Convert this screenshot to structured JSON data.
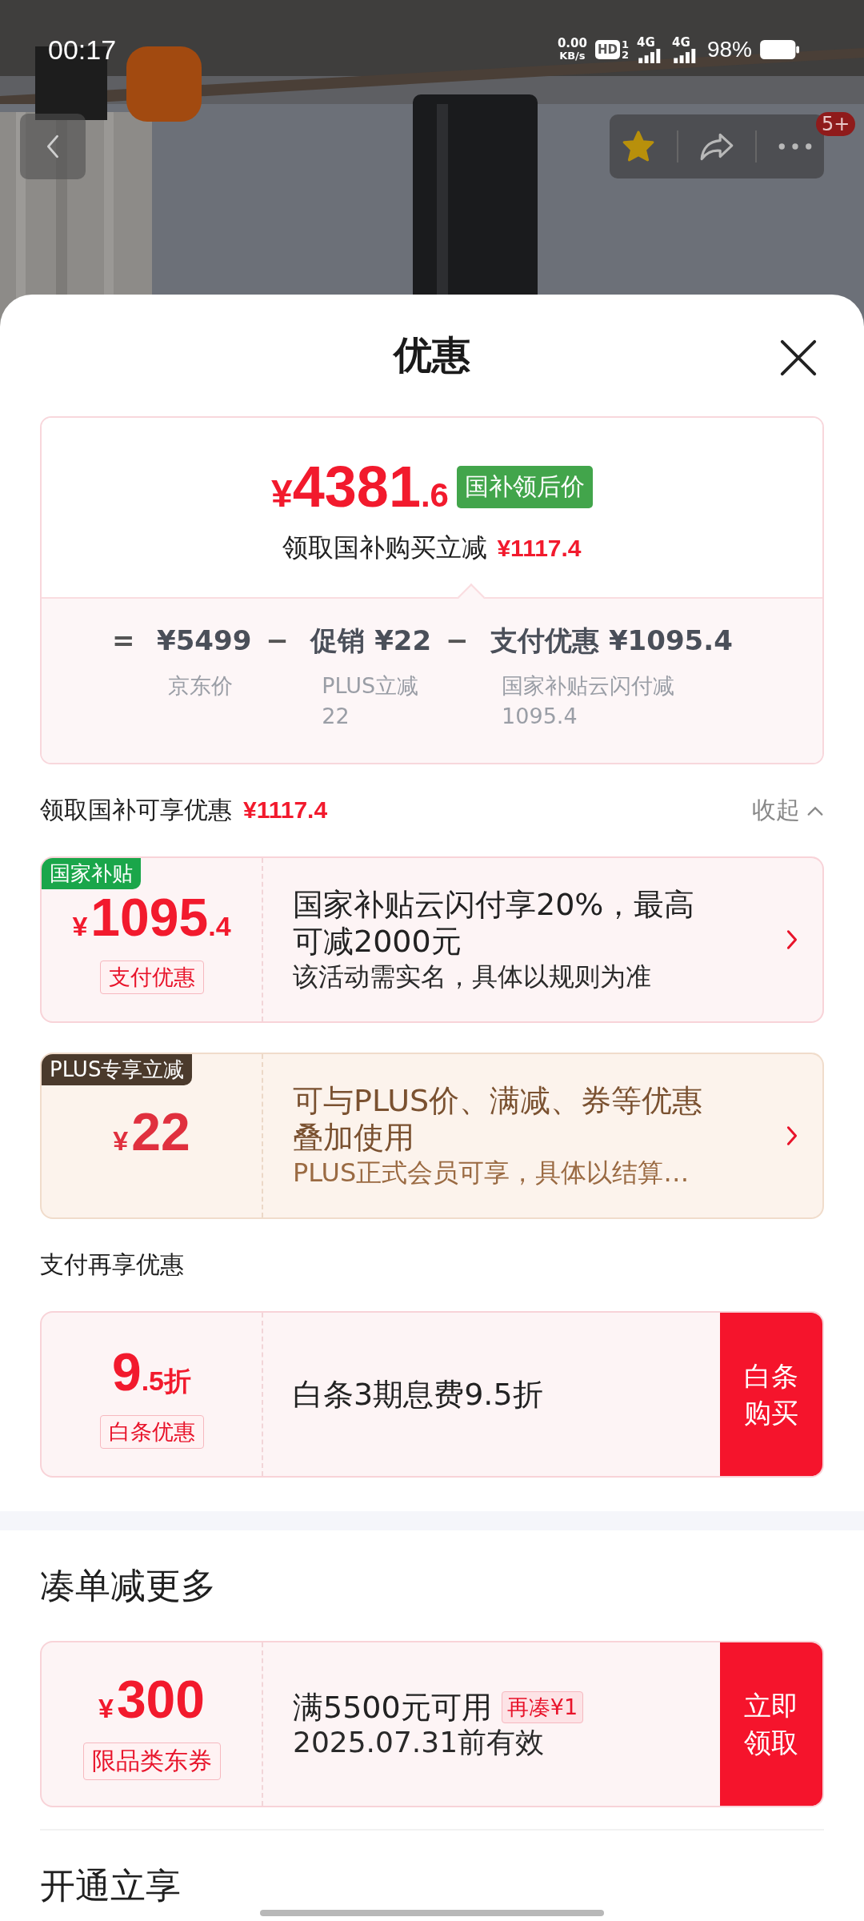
{
  "status_bar": {
    "time": "00:17",
    "net_speed": "0.00",
    "net_unit": "KB/s",
    "hd": "HD",
    "hd_slots": [
      "1",
      "2"
    ],
    "signals": [
      {
        "network": "4G"
      },
      {
        "network": "4G"
      }
    ],
    "battery": "98%"
  },
  "header": {
    "favorite": true,
    "badge": "5+"
  },
  "sheet": {
    "title": "优惠"
  },
  "price_card": {
    "currency": "¥",
    "price_main": "4381",
    "price_decimal": ".6",
    "price_tag": "国补领后价",
    "saving_label": "领取国补购买立减",
    "saving_amount": "¥1117.4",
    "breakdown": [
      {
        "operator": "=",
        "value": "¥5499",
        "note_lines": [
          "京东价"
        ]
      },
      {
        "operator": "−",
        "value": "促销 ¥22",
        "note_lines": [
          "PLUS立减",
          "22"
        ]
      },
      {
        "operator": "−",
        "value": "支付优惠 ¥1095.4",
        "note_lines": [
          "国家补贴云闪付减",
          "1095.4"
        ]
      }
    ]
  },
  "sections": [
    {
      "kind": "subheading",
      "title": "领取国补可享优惠",
      "amount": "¥1117.4",
      "toggle": "收起",
      "expanded": true,
      "coupons": [
        {
          "kind": "standard",
          "tag": {
            "label": "国家补贴",
            "color": "#1aa64a"
          },
          "amount_prefix": "¥",
          "amount_main": "1095",
          "amount_suffix": ".4",
          "badge": "支付优惠",
          "title": "国家补贴云闪付享20%，最高可减2000元",
          "subtitle": "该活动需实名，具体以规则为准",
          "action": {
            "kind": "chevron"
          }
        },
        {
          "kind": "plus",
          "tag": {
            "label": "PLUS专享立减",
            "color": "#4b3a2c"
          },
          "amount_prefix": "¥",
          "amount_main": "22",
          "title": "可与PLUS价、满减、券等优惠叠加使用",
          "subtitle": "PLUS正式会员可享，具体以结算…",
          "action": {
            "kind": "chevron"
          }
        }
      ]
    },
    {
      "kind": "subheading",
      "title": "支付再享优惠",
      "coupons": [
        {
          "kind": "standard",
          "amount_main": "9",
          "amount_suffix": ".5折",
          "badge": "白条优惠",
          "title": "白条3期息费9.5折",
          "action": {
            "kind": "button",
            "label": "白条购买"
          }
        }
      ]
    },
    {
      "kind": "heading",
      "band_above": true,
      "title": "凑单减更多",
      "coupons": [
        {
          "kind": "voucher",
          "amount_prefix": "¥",
          "amount_main": "300",
          "badge": "限品类东券",
          "title": "满5500元可用",
          "title_tag": "再凑¥1",
          "subtitle": "2025.07.31前有效",
          "action": {
            "kind": "button",
            "label": "立即领取"
          }
        }
      ]
    },
    {
      "kind": "heading",
      "rule_above": true,
      "title": "开通立享"
    }
  ]
}
